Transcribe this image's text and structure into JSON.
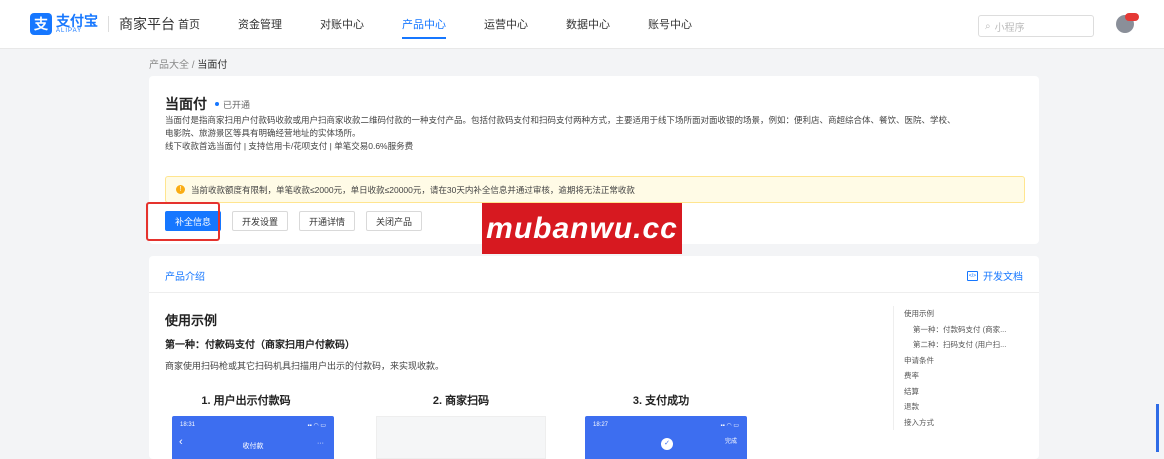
{
  "header": {
    "logo_mark": "支",
    "logo_cn": "支付宝",
    "logo_en": "ALIPAY",
    "platform": "商家平台",
    "nav": [
      "首页",
      "资金管理",
      "对账中心",
      "产品中心",
      "运营中心",
      "数据中心",
      "账号中心"
    ],
    "active_nav": "产品中心",
    "search_placeholder": "小程序"
  },
  "breadcrumb": {
    "parent": "产品大全",
    "sep": "/",
    "current": "当面付"
  },
  "product": {
    "title": "当面付",
    "status": "已开通",
    "desc_lines": [
      "当面付是指商家扫用户付款码收款或用户扫商家收款二维码付款的一种支付产品。包括付款码支付和扫码支付两种方式，主要适用于线下场所面对面收银的场景，例如：便利店、商超综合体、餐饮、医院、学校、",
      "电影院、旅游景区等具有明确经营地址的实体场所。",
      "线下收款首选当面付 | 支持信用卡/花呗支付 | 单笔交易0.6%服务费"
    ],
    "notice": "当前收款额度有限制，单笔收款≤2000元，单日收款≤20000元，请在30天内补全信息并通过审核，逾期将无法正常收款",
    "buttons": [
      "补全信息",
      "开发设置",
      "开通详情",
      "关闭产品"
    ]
  },
  "watermark": "mubanwu.cc",
  "intro": {
    "tab": "产品介绍",
    "dev_docs": "开发文档",
    "heading": "使用示例",
    "method1_title": "第一种：付款码支付（商家扫用户付款码）",
    "method1_desc": "商家使用扫码枪或其它扫码机具扫描用户出示的付款码，来实现收款。",
    "steps": [
      "1. 用户出示付款码",
      "2. 商家扫码",
      "3. 支付成功"
    ],
    "phone1": {
      "time": "18:31",
      "title": "收付款",
      "back": "‹",
      "more": "···"
    },
    "phone3": {
      "time": "18:27",
      "action": "完成"
    },
    "toc": [
      "使用示例",
      "第一种：付款码支付 (商家...",
      "第二种：扫码支付 (用户扫...",
      "申请条件",
      "费率",
      "结算",
      "退款",
      "接入方式"
    ]
  },
  "colors": {
    "brand": "#1677ff",
    "highlight": "#e5322d",
    "watermark_bg": "#d71920"
  }
}
